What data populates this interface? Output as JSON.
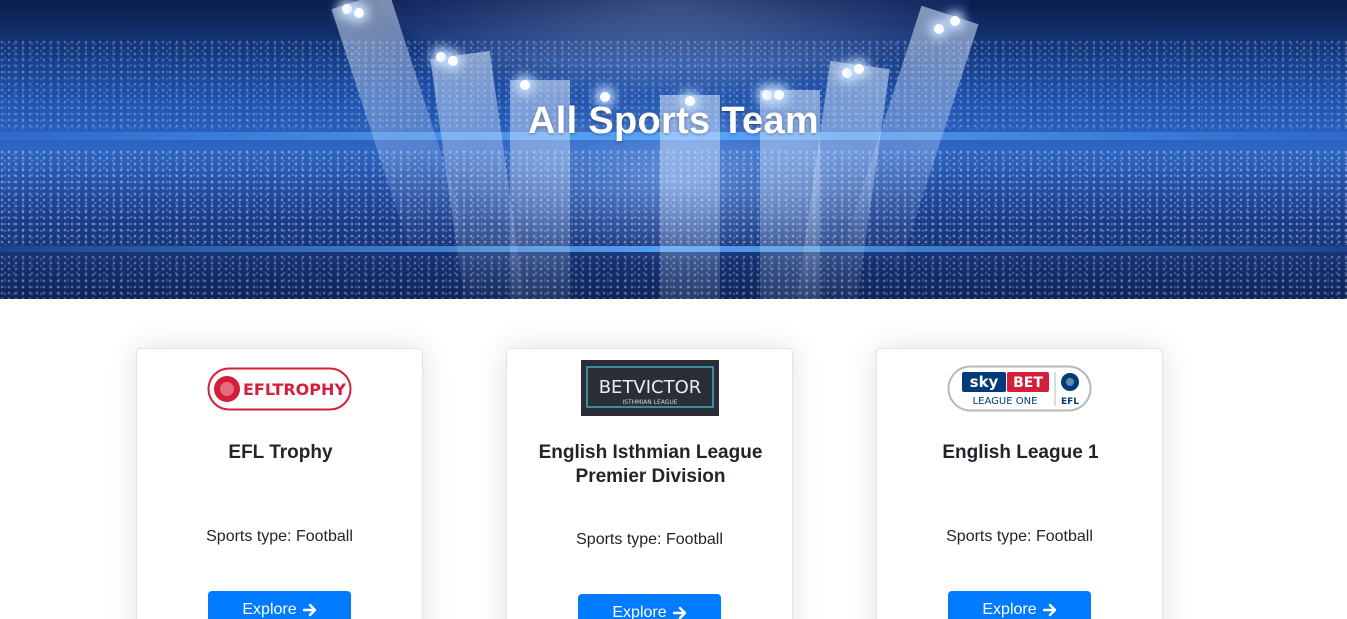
{
  "hero": {
    "title": "All Sports Team"
  },
  "cards": [
    {
      "logo_text": "EFLTROPHY",
      "logo_colors": {
        "primary": "#d41e3a",
        "border": "#d41e3a"
      },
      "title": "EFL Trophy",
      "sports_type": "Sports type: Football",
      "button_label": "Explore"
    },
    {
      "logo_text": "BETVICTOR",
      "logo_subtext": "ISTHMIAN LEAGUE",
      "logo_colors": {
        "background": "#2a2f36"
      },
      "title": "English Isthmian League Premier Division",
      "sports_type": "Sports type: Football",
      "button_label": "Explore"
    },
    {
      "logo_text_sky": "sky",
      "logo_text_bet": "BET",
      "logo_subtext": "LEAGUE ONE",
      "logo_efl": "EFL",
      "logo_colors": {
        "sky": "#003a78",
        "bet": "#d41e3a"
      },
      "title": "English League 1",
      "sports_type": "Sports type: Football",
      "button_label": "Explore"
    }
  ],
  "colors": {
    "button": "#007bff",
    "hero": "#2e66c4"
  },
  "icons": {
    "button_icon": "arrow-right-icon"
  }
}
